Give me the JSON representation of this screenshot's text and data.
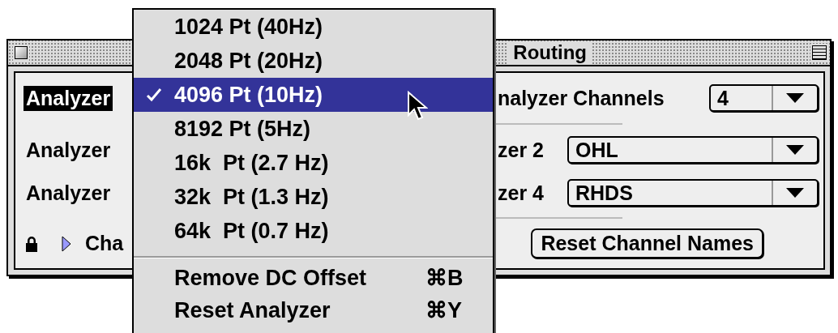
{
  "window": {
    "title": "Routing"
  },
  "left_rows": [
    {
      "label": "Analyzer",
      "selected": true
    },
    {
      "label": "Analyzer",
      "selected": false
    },
    {
      "label": "Analyzer",
      "selected": false
    }
  ],
  "disclosure": {
    "label": "Cha",
    "expanded": false
  },
  "channels": {
    "label": "nalyzer Channels",
    "value": "4"
  },
  "assignments": [
    {
      "label": "zer 2",
      "value": "OHL"
    },
    {
      "label": "zer 4",
      "value": "RHDS"
    }
  ],
  "reset_button": "Reset Channel Names",
  "menu": {
    "options": [
      {
        "label": "1024 Pt (40Hz)",
        "checked": false,
        "selected": false
      },
      {
        "label": "2048 Pt (20Hz)",
        "checked": false,
        "selected": false
      },
      {
        "label": "4096 Pt (10Hz)",
        "checked": true,
        "selected": true
      },
      {
        "label": "8192 Pt (5Hz)",
        "checked": false,
        "selected": false
      },
      {
        "label": "16k  Pt (2.7 Hz)",
        "checked": false,
        "selected": false
      },
      {
        "label": "32k  Pt (1.3 Hz)",
        "checked": false,
        "selected": false
      },
      {
        "label": "64k  Pt (0.7 Hz)",
        "checked": false,
        "selected": false
      }
    ],
    "commands": [
      {
        "label": "Remove DC Offset",
        "shortcut": "⌘B"
      },
      {
        "label": "Reset Analyzer",
        "shortcut": "⌘Y"
      }
    ]
  }
}
